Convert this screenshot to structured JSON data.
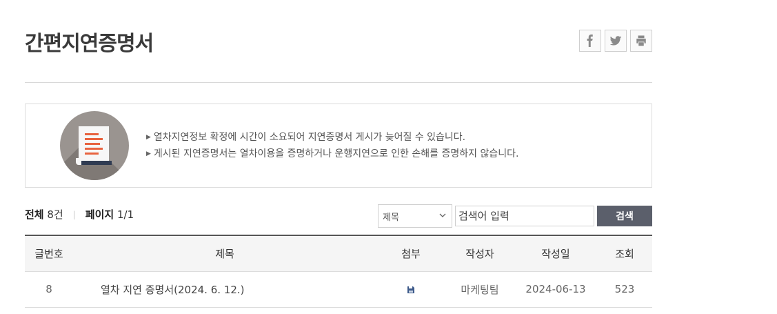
{
  "page": {
    "title": "간편지연증명서"
  },
  "share": [
    {
      "name": "facebook-icon",
      "label": "f"
    },
    {
      "name": "twitter-icon",
      "label": "twitter"
    },
    {
      "name": "print-icon",
      "label": "print"
    }
  ],
  "notice": {
    "lines": [
      "열차지연정보 확정에 시간이 소요되어 지연증명서 게시가 늦어질 수 있습니다.",
      "게시된 지연증명서는 열차이용을 증명하거나 운행지연으로 인한 손해를 증명하지 않습니다."
    ]
  },
  "summary": {
    "total_label": "전체",
    "total_value": "8건",
    "page_label": "페이지",
    "page_value": "1/1"
  },
  "search": {
    "select_value": "제목",
    "placeholder": "검색어 입력",
    "button_label": "검색"
  },
  "table": {
    "headers": [
      "글번호",
      "제목",
      "첨부",
      "작성자",
      "작성일",
      "조회"
    ],
    "rows": [
      {
        "no": "8",
        "title": "열차 지연 증명서(2024. 6. 12.)",
        "author": "마케팅팀",
        "date": "2024-06-13",
        "views": "523"
      }
    ]
  },
  "colors": {
    "search_button": "#5b5f6b",
    "icon_accent": "#e8633f",
    "icon_circle": "#9a9490"
  }
}
